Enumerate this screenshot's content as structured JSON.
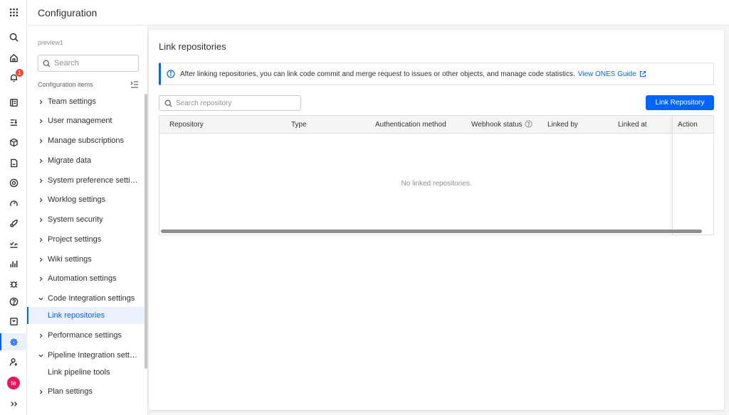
{
  "header": {
    "title": "Configuration"
  },
  "rail": {
    "notification_count": "1",
    "avatar_initials": "te"
  },
  "sidebar": {
    "team_name": "preview1",
    "search_placeholder": "Search",
    "section_label": "Configuration items",
    "items": [
      {
        "label": "Team settings",
        "expanded": false
      },
      {
        "label": "User management",
        "expanded": false
      },
      {
        "label": "Manage subscriptions",
        "expanded": false
      },
      {
        "label": "Migrate data",
        "expanded": false
      },
      {
        "label": "System preference settings",
        "expanded": false
      },
      {
        "label": "Worklog settings",
        "expanded": false
      },
      {
        "label": "System security",
        "expanded": false
      },
      {
        "label": "Project settings",
        "expanded": false
      },
      {
        "label": "Wiki settings",
        "expanded": false
      },
      {
        "label": "Automation settings",
        "expanded": false
      },
      {
        "label": "Code Integration settings",
        "expanded": true,
        "children": [
          "Link repositories"
        ]
      },
      {
        "label": "Performance settings",
        "expanded": false
      },
      {
        "label": "Pipeline Integration settings",
        "expanded": true,
        "children": [
          "Link pipeline tools"
        ]
      },
      {
        "label": "Plan settings",
        "expanded": false
      }
    ]
  },
  "main": {
    "title": "Link repositories",
    "info_text": "After linking repositories, you can link code commit and merge request to issues or other objects, and manage code statistics.",
    "guide_link": "View ONES Guide",
    "search_placeholder": "Search repository",
    "link_button": "Link Repository",
    "columns": [
      "Repository",
      "Type",
      "Authentication method",
      "Webhook status",
      "Linked by",
      "Linked at",
      "Action"
    ],
    "empty_text": "No linked repositories."
  },
  "colors": {
    "accent": "#0064ff",
    "badge": "#f0473a",
    "avatar": "#e5195a"
  }
}
